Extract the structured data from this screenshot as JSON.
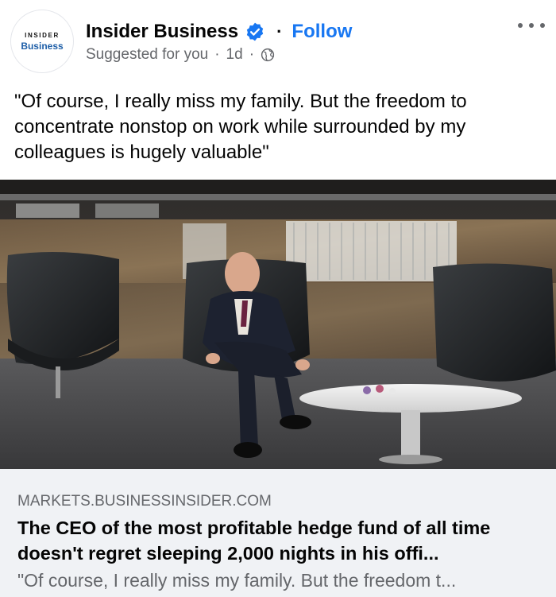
{
  "post": {
    "avatar_top": "INSIDER",
    "avatar_bottom": "Business",
    "page_name": "Insider Business",
    "follow_label": "Follow",
    "separator": "·",
    "suggested": "Suggested for you",
    "time": "1d",
    "text": "\"Of course, I really miss my family. But the freedom to concentrate nonstop on work while surrounded by my colleagues is hugely valuable\""
  },
  "link": {
    "domain": "MARKETS.BUSINESSINSIDER.COM",
    "headline": "The CEO of the most profitable hedge fund of all time doesn't regret sleeping 2,000 nights in his offi...",
    "snippet": "\"Of course, I really miss my family. But the freedom t..."
  },
  "colors": {
    "accent": "#1877f2",
    "secondary_text": "#65676b",
    "card_bg": "#f0f2f5"
  },
  "icons": [
    "verified-badge-icon",
    "globe-icon",
    "more-options-icon"
  ]
}
